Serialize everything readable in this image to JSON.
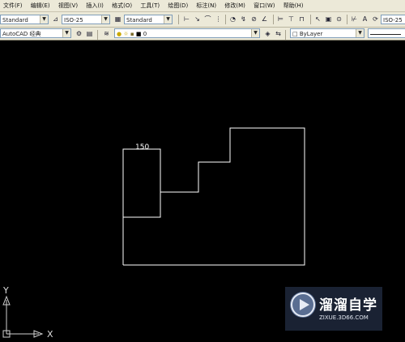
{
  "menu": [
    "文件(F)",
    "编辑(E)",
    "视图(V)",
    "插入(I)",
    "格式(O)",
    "工具(T)",
    "绘图(D)",
    "标注(N)",
    "修改(M)",
    "窗口(W)",
    "帮助(H)"
  ],
  "toolbar1": {
    "text_style": "Standard",
    "dim_style": "ISO-25",
    "table_style": "Standard",
    "right_combo": "ISO-25"
  },
  "toolbar2": {
    "workspace": "AutoCAD 经典",
    "layer": "0",
    "color": "ByLayer"
  },
  "drawing": {
    "dimension_text": "150"
  },
  "ucs": {
    "x_label": "X",
    "y_label": "Y"
  },
  "watermark": {
    "title": "溜溜自学",
    "subtitle": "ZIXUE.3D66.COM"
  }
}
